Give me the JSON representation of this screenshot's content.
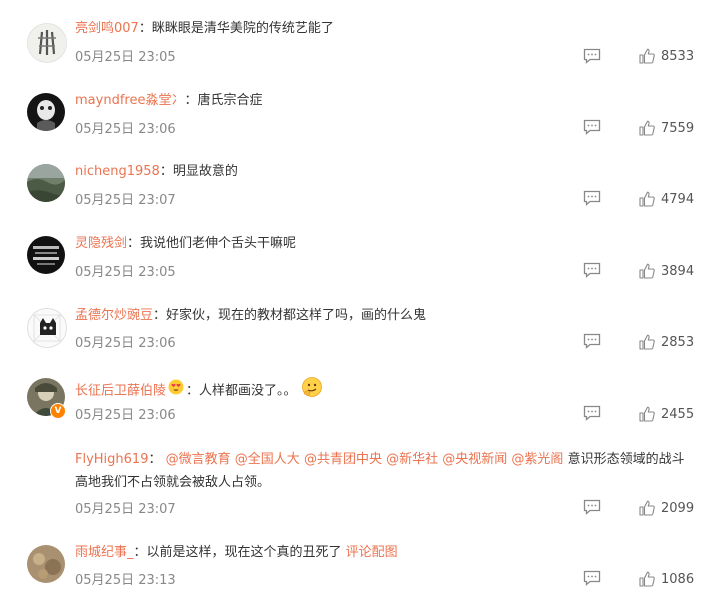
{
  "comments": [
    {
      "user": "亮剑鸣007",
      "text": "：眯眯眼是清华美院的传统艺能了",
      "time": "05月25日 23:05",
      "likes": "8533"
    },
    {
      "user": "mayndfree淼堂冫",
      "text": "：唐氏宗合症",
      "time": "05月25日 23:06",
      "likes": "7559"
    },
    {
      "user": "nicheng1958",
      "text": "：明显故意的",
      "time": "05月25日 23:07",
      "likes": "4794"
    },
    {
      "user": "灵隐残剑",
      "text": "：我说他们老伸个舌头干嘛呢",
      "time": "05月25日 23:05",
      "likes": "3894"
    },
    {
      "user": "孟德尔炒豌豆",
      "text": "：好家伙，现在的教材都这样了吗，画的什么鬼",
      "time": "05月25日 23:06",
      "likes": "2853"
    },
    {
      "user": "长征后卫薛伯陵",
      "text_before": "：人样都画没了。。",
      "time": "05月25日 23:06",
      "likes": "2455",
      "badge": "V"
    },
    {
      "user": "FlyHigh619",
      "sep": "：",
      "mentions": [
        "@微言教育",
        "@全国人大",
        "@共青团中央",
        "@新华社",
        "@央视新闻",
        "@紫光阁"
      ],
      "text": "意识形态领域的战斗高地我们不占领就会被敌人占领。",
      "time": "05月25日 23:07",
      "likes": "2099"
    },
    {
      "user": "雨城纪事_",
      "text": "：以前是这样，现在这个真的丑死了",
      "link": "评论配图",
      "time": "05月25日 23:13",
      "likes": "1086"
    }
  ],
  "colors": {
    "username": "#eb7350",
    "time": "#888888",
    "text": "#333333"
  }
}
